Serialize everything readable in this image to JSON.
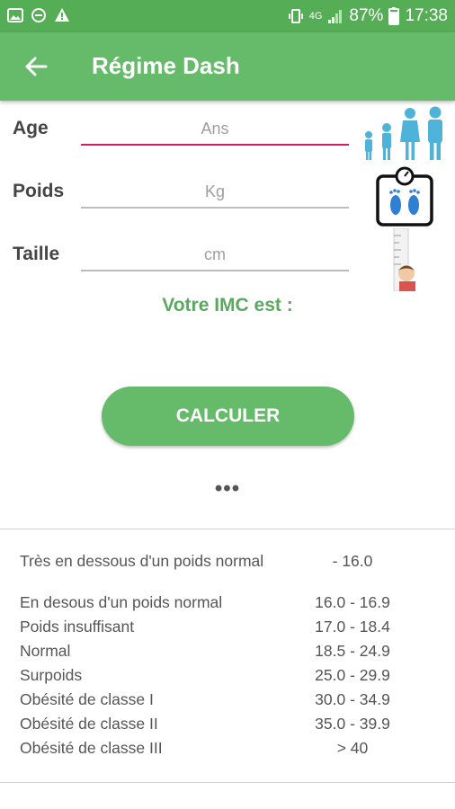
{
  "status_bar": {
    "battery": "87%",
    "time": "17:38",
    "network": "4G",
    "icons": [
      "image-icon",
      "dnd-icon",
      "warning-icon",
      "vibrate-icon",
      "signal-icon",
      "battery-icon"
    ]
  },
  "app_bar": {
    "title": "Régime Dash",
    "back_icon": "arrow-left-icon"
  },
  "form": {
    "age": {
      "label": "Age",
      "placeholder": "Ans"
    },
    "poids": {
      "label": "Poids",
      "placeholder": "Kg"
    },
    "taille": {
      "label": "Taille",
      "placeholder": "cm"
    }
  },
  "result_label": "Votre IMC est :",
  "calc_button": "CALCULER",
  "more": "•••",
  "imc_table": [
    {
      "label": "Très en dessous d'un poids normal",
      "value": "- 16.0"
    },
    {
      "label": "En desous d'un poids normal",
      "value": "16.0 - 16.9"
    },
    {
      "label": "Poids insuffisant",
      "value": "17.0 - 18.4"
    },
    {
      "label": "Normal",
      "value": "18.5 - 24.9"
    },
    {
      "label": "Surpoids",
      "value": "25.0 - 29.9"
    },
    {
      "label": "Obésité de classe I",
      "value": "30.0 - 34.9"
    },
    {
      "label": "Obésité de classe II",
      "value": "35.0 - 39.9"
    },
    {
      "label": "Obésité de classe III",
      "value": "> 40"
    }
  ],
  "colors": {
    "status_bar": "#55ad55",
    "app_bar": "#66bb6a",
    "accent_green": "#5aa95e",
    "active_underline": "#d81b60",
    "figure_blue": "#4fb3d9"
  }
}
